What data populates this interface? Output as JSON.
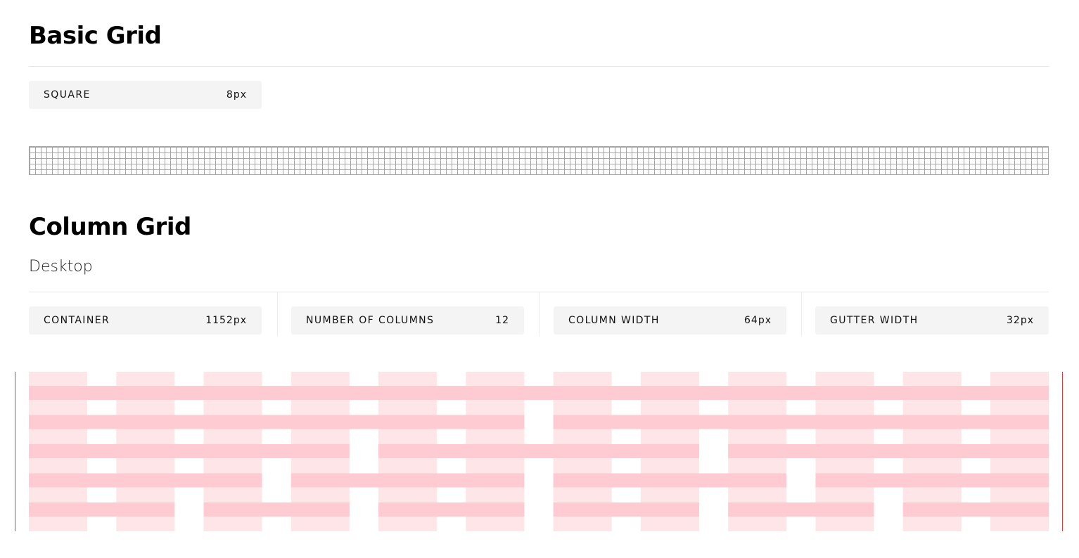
{
  "basic_grid": {
    "title": "Basic Grid",
    "spec": {
      "label": "SQUARE",
      "value": "8px"
    },
    "square_size": 8
  },
  "column_grid": {
    "title": "Column Grid",
    "subtitle": "Desktop",
    "specs": [
      {
        "label": "CONTAINER",
        "value": "1152px"
      },
      {
        "label": "NUMBER OF COLUMNS",
        "value": "12"
      },
      {
        "label": "COLUMN WIDTH",
        "value": "64px"
      },
      {
        "label": "GUTTER WIDTH",
        "value": "32px"
      }
    ],
    "columns": 12,
    "row_spans": [
      12,
      6,
      4,
      3,
      2
    ],
    "colors": {
      "column": "#fde5e8",
      "span_bar": "#fecbd2",
      "edge_line": "#e53935"
    }
  },
  "colors": {
    "spec_bg": "#f4f4f4",
    "divider": "#e6e6e6",
    "grid_line": "#a6a6a6"
  }
}
